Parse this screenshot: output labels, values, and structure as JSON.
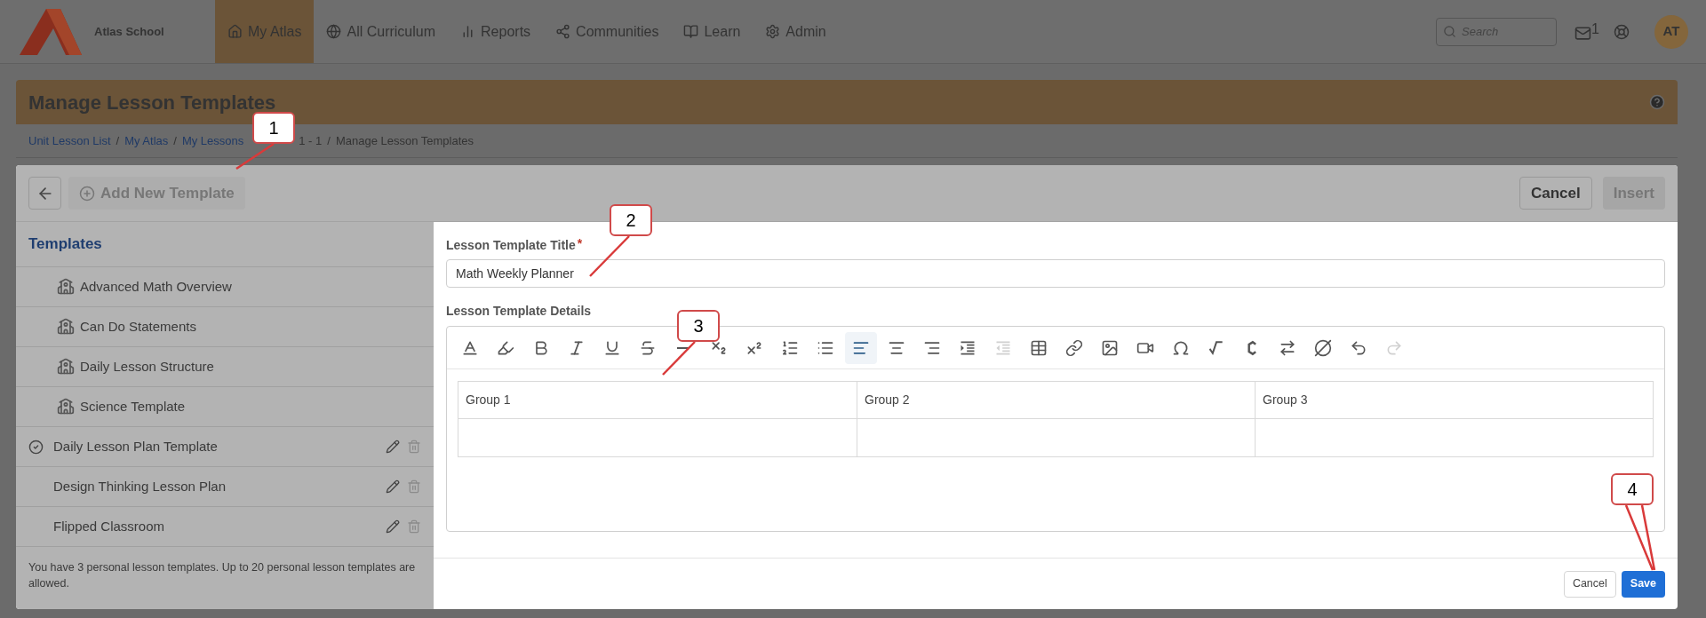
{
  "nav": {
    "school": "Atlas School",
    "tabs": [
      {
        "label": "My Atlas",
        "kind": "home",
        "selected": true
      },
      {
        "label": "All Curriculum",
        "kind": "globe",
        "selected": false
      },
      {
        "label": "Reports",
        "kind": "chart",
        "selected": false
      },
      {
        "label": "Communities",
        "kind": "network",
        "selected": false
      },
      {
        "label": "Learn",
        "kind": "book",
        "selected": false
      },
      {
        "label": "Admin",
        "kind": "gear",
        "selected": false
      }
    ],
    "search": {
      "placeholder": "Search"
    },
    "mail_count": "1",
    "avatar": "AT"
  },
  "page": {
    "title": "Manage Lesson Templates",
    "breadcrumbs": [
      {
        "label": "Unit Lesson List",
        "link": true
      },
      {
        "label": "My Atlas",
        "link": true,
        "separator": "/"
      },
      {
        "label": "My Lessons",
        "link": true,
        "separator": "/"
      },
      {
        "label": "1 - 1",
        "link": false
      },
      {
        "label": "Manage Lesson Templates",
        "link": false,
        "separator": "/"
      }
    ]
  },
  "dialog": {
    "add_button": "Add New Template",
    "cancel": "Cancel",
    "insert": "Insert",
    "sidebar": {
      "heading": "Templates",
      "items": [
        {
          "name": "Advanced Math Overview",
          "kind": "shared",
          "checked": false
        },
        {
          "name": "Can Do Statements",
          "kind": "shared",
          "checked": false
        },
        {
          "name": "Daily Lesson Structure",
          "kind": "shared",
          "checked": false
        },
        {
          "name": "Science Template",
          "kind": "shared",
          "checked": false
        },
        {
          "name": "Daily Lesson Plan Template",
          "kind": "personal",
          "checked": true
        },
        {
          "name": "Design Thinking Lesson Plan",
          "kind": "personal",
          "checked": false
        },
        {
          "name": "Flipped Classroom",
          "kind": "personal",
          "checked": false
        }
      ],
      "note": "You have 3 personal lesson templates. Up to 20 personal lesson templates are allowed."
    },
    "title_label": "Lesson Template Title",
    "required_mark": "*",
    "title_value": "Math Weekly Planner",
    "details_label": "Lesson Template Details",
    "toolbar": [
      {
        "kind": "text-color",
        "selected": false,
        "disabled": false
      },
      {
        "kind": "highlight",
        "selected": false,
        "disabled": false
      },
      {
        "kind": "bold",
        "selected": false,
        "disabled": false
      },
      {
        "kind": "italic",
        "selected": false,
        "disabled": false
      },
      {
        "kind": "underline",
        "selected": false,
        "disabled": false
      },
      {
        "kind": "strike",
        "selected": false,
        "disabled": false
      },
      {
        "kind": "rule",
        "selected": false,
        "disabled": false
      },
      {
        "kind": "subscript",
        "selected": false,
        "disabled": false
      },
      {
        "kind": "superscript",
        "selected": false,
        "disabled": false
      },
      {
        "kind": "ordered-list",
        "selected": false,
        "disabled": false
      },
      {
        "kind": "bullet-list",
        "selected": false,
        "disabled": false
      },
      {
        "kind": "align-left",
        "selected": true,
        "disabled": false
      },
      {
        "kind": "align-center",
        "selected": false,
        "disabled": false
      },
      {
        "kind": "align-right",
        "selected": false,
        "disabled": false
      },
      {
        "kind": "indent",
        "selected": false,
        "disabled": false
      },
      {
        "kind": "outdent",
        "selected": false,
        "disabled": true
      },
      {
        "kind": "table",
        "selected": false,
        "disabled": false
      },
      {
        "kind": "link",
        "selected": false,
        "disabled": false
      },
      {
        "kind": "image",
        "selected": false,
        "disabled": false
      },
      {
        "kind": "video",
        "selected": false,
        "disabled": false
      },
      {
        "kind": "omega",
        "selected": false,
        "disabled": false
      },
      {
        "kind": "math",
        "selected": false,
        "disabled": false
      },
      {
        "kind": "code",
        "selected": false,
        "disabled": false
      },
      {
        "kind": "swap",
        "selected": false,
        "disabled": false
      },
      {
        "kind": "clear",
        "selected": false,
        "disabled": false
      },
      {
        "kind": "undo",
        "selected": false,
        "disabled": false
      },
      {
        "kind": "redo",
        "selected": false,
        "disabled": true
      }
    ],
    "table": {
      "columns": [
        "Group 1",
        "Group 2",
        "Group 3"
      ]
    },
    "footer_cancel": "Cancel",
    "footer_save": "Save"
  },
  "callouts": [
    "1",
    "2",
    "3",
    "4"
  ]
}
